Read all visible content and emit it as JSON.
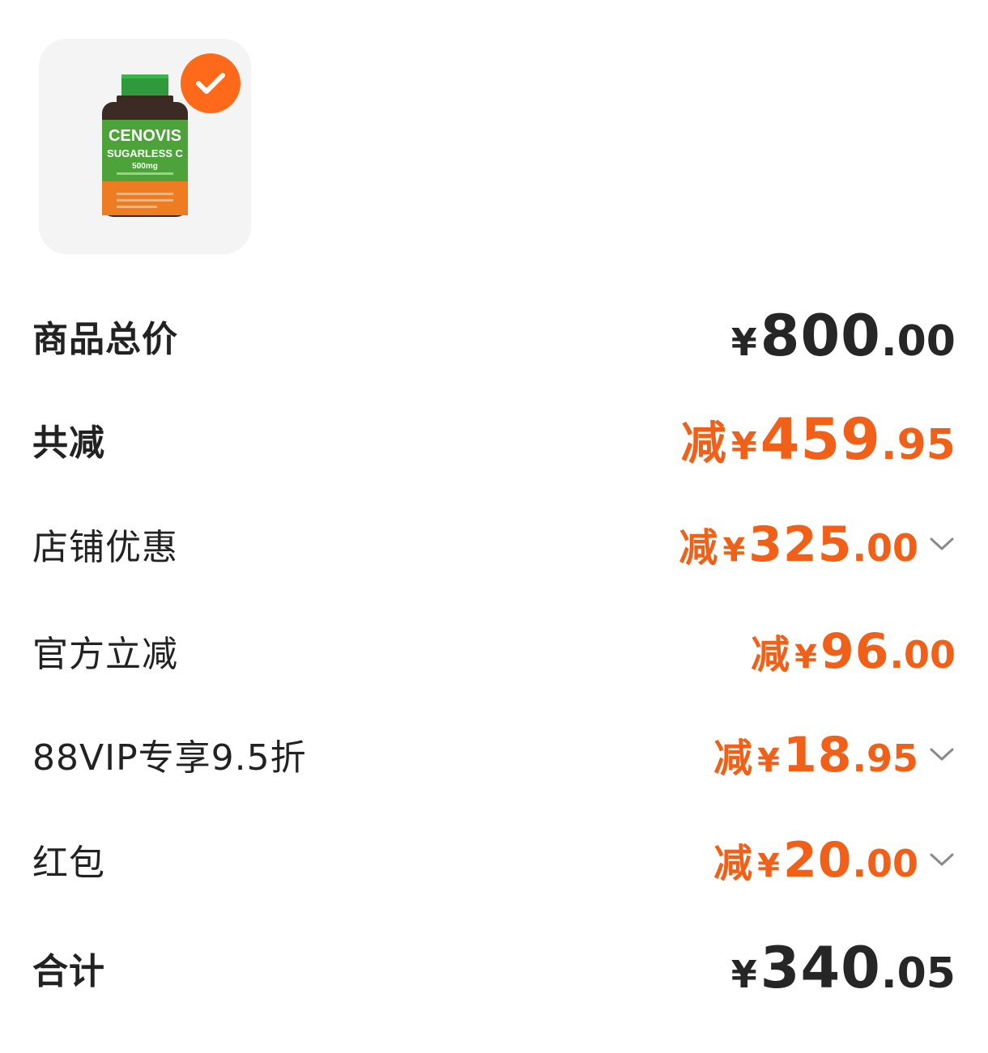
{
  "product": {
    "icon": "supplement-bottle-image",
    "brand_label": "CENOVIS",
    "product_label": "SUGARLESS C",
    "dose_label": "500mg",
    "selected": true,
    "check_color": "#ff6a1a"
  },
  "rows": [
    {
      "label": "商品总价",
      "prefix": "",
      "currency": "¥",
      "int": "800",
      "dec": ".00",
      "chevron": false
    },
    {
      "label": "共减",
      "prefix": "减",
      "currency": "¥",
      "int": "459",
      "dec": ".95",
      "chevron": false
    },
    {
      "label": "店铺优惠",
      "prefix": "减",
      "currency": "¥",
      "int": "325",
      "dec": ".00",
      "chevron": true
    },
    {
      "label": "官方立减",
      "prefix": "减",
      "currency": "¥",
      "int": "96",
      "dec": ".00",
      "chevron": false
    },
    {
      "label": "88VIP专享9.5折",
      "prefix": "减",
      "currency": "¥",
      "int": "18",
      "dec": ".95",
      "chevron": true
    },
    {
      "label": "红包",
      "prefix": "减",
      "currency": "¥",
      "int": "20",
      "dec": ".00",
      "chevron": true
    },
    {
      "label": "合计",
      "prefix": "",
      "currency": "¥",
      "int": "340",
      "dec": ".05",
      "chevron": false
    }
  ],
  "colors": {
    "discount": "#f06018",
    "text": "#222222"
  }
}
